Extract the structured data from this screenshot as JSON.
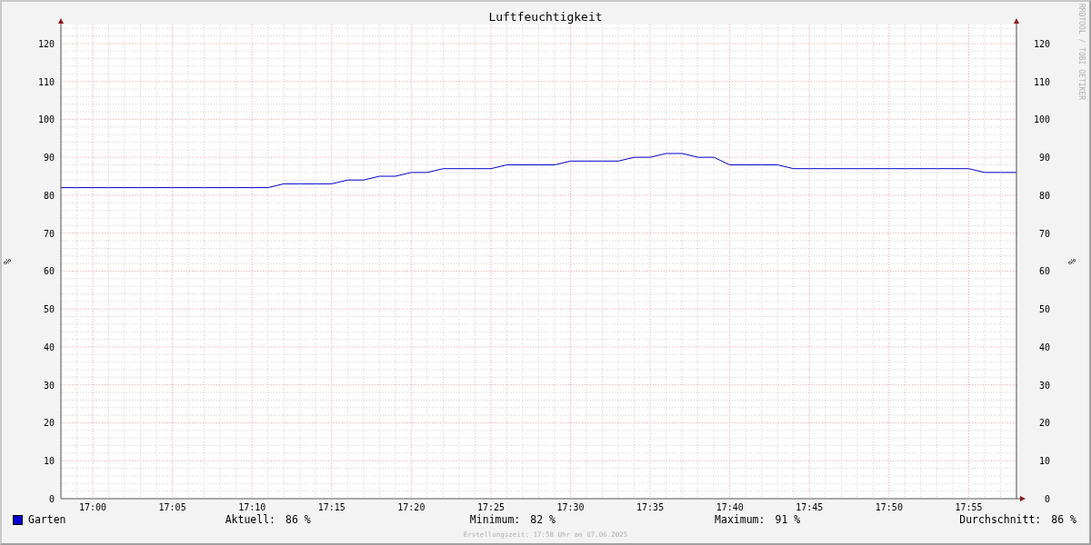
{
  "title": "Luftfeuchtigkeit",
  "watermark": "RRDTOOL / TOBI OETIKER",
  "chart_data": {
    "type": "line",
    "grid": true,
    "ylabel": "%",
    "ylim": [
      0,
      125
    ],
    "categories": [
      null,
      null,
      "17:00",
      null,
      null,
      null,
      null,
      "17:05",
      null,
      null,
      null,
      null,
      "17:10",
      null,
      null,
      null,
      null,
      "17:15",
      null,
      null,
      null,
      null,
      "17:20",
      null,
      null,
      null,
      null,
      "17:25",
      null,
      null,
      null,
      null,
      "17:30",
      null,
      null,
      null,
      null,
      "17:35",
      null,
      null,
      null,
      null,
      "17:40",
      null,
      null,
      null,
      null,
      "17:45",
      null,
      null,
      null,
      null,
      "17:50",
      null,
      null,
      null,
      null,
      "17:55",
      null,
      null,
      null
    ],
    "series": [
      {
        "name": "Garten",
        "color": "#0000cc",
        "values": [
          82,
          82,
          82,
          82,
          82,
          82,
          82,
          82,
          82,
          82,
          82,
          82,
          82,
          82,
          83,
          83,
          83,
          83,
          84,
          84,
          85,
          85,
          86,
          86,
          87,
          87,
          87,
          87,
          88,
          88,
          88,
          88,
          89,
          89,
          89,
          89,
          90,
          90,
          91,
          91,
          90,
          90,
          88,
          88,
          88,
          88,
          87,
          87,
          87,
          87,
          87,
          87,
          87,
          87,
          87,
          87,
          87,
          87,
          86,
          86,
          86
        ]
      }
    ],
    "yticks": [
      0,
      10,
      20,
      30,
      40,
      50,
      60,
      70,
      80,
      90,
      100,
      110,
      120
    ]
  },
  "right_axis": {
    "label": "%",
    "ticks": [
      "120",
      "110",
      "100",
      "90",
      "80",
      "70",
      "60",
      "50",
      "40",
      "30",
      "20",
      "10",
      "0"
    ]
  },
  "legend": {
    "stats": [
      {
        "label": "Aktuell:",
        "value": "86 %"
      },
      {
        "label": "Minimum:",
        "value": "82 %"
      },
      {
        "label": "Maximum:",
        "value": "91 %"
      },
      {
        "label": "Durchschnitt:",
        "value": "86 %"
      }
    ]
  },
  "footer": "Erstellungszeit: 17:58 Uhr am 07.06.2025"
}
